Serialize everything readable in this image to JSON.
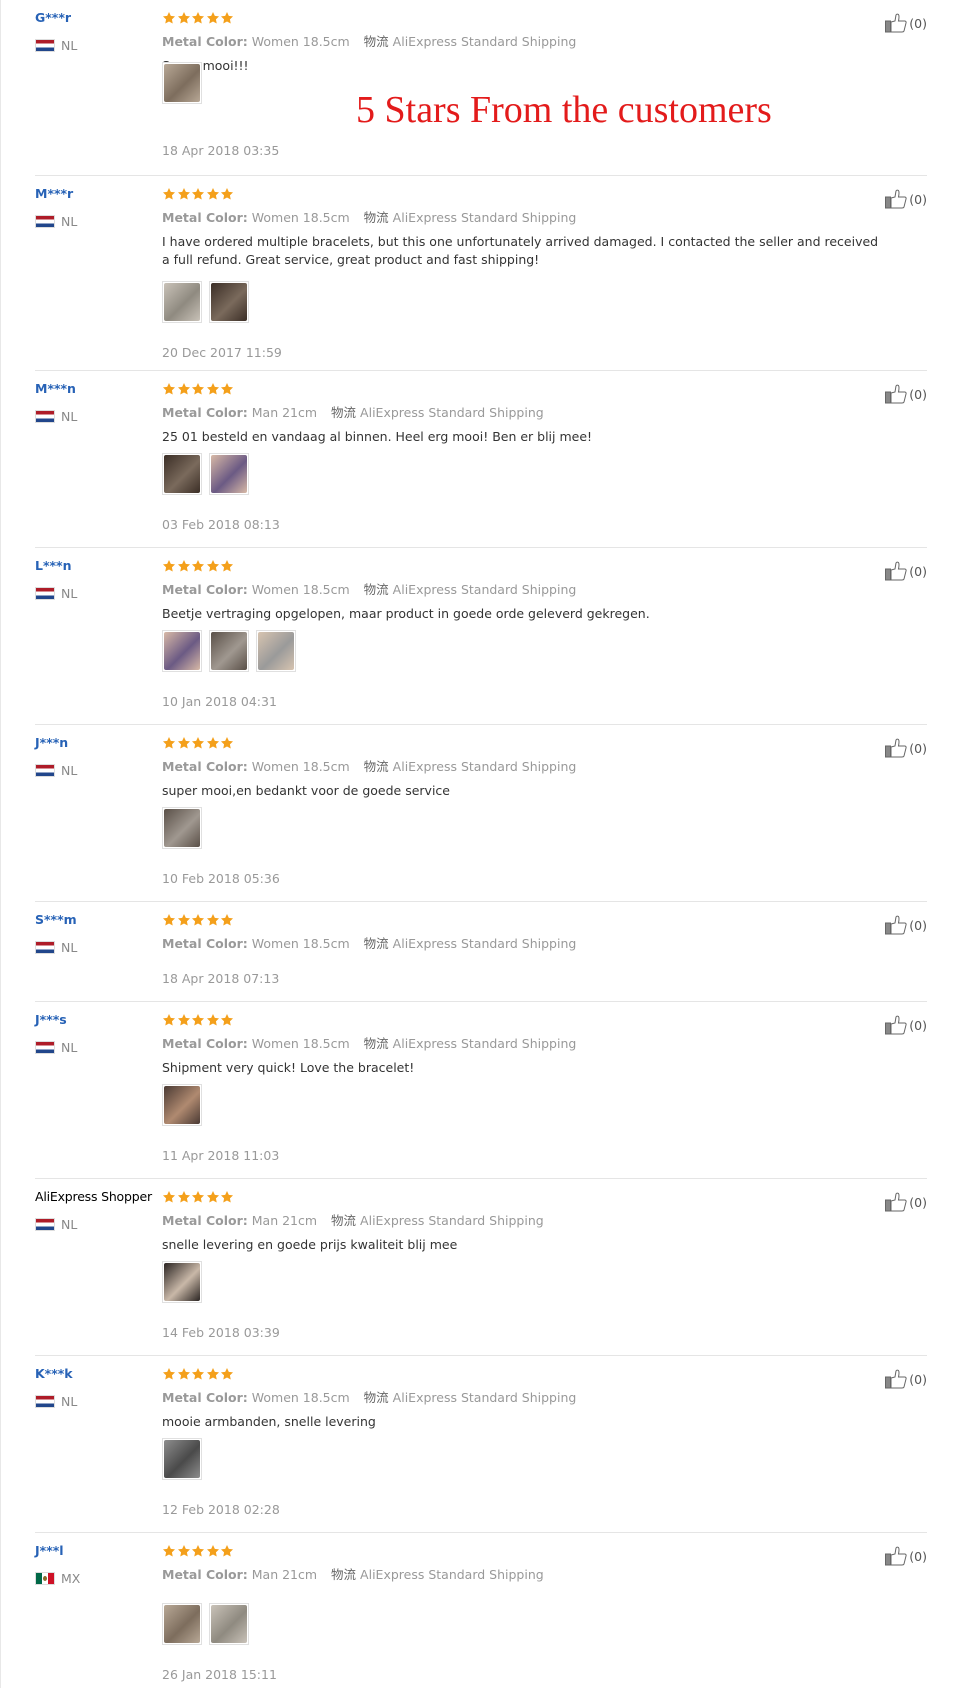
{
  "banner": {
    "text": "5 Stars From the customers",
    "color": "#e31b1b"
  },
  "attr_label": "Metal Color:",
  "shipping_label": "物流",
  "reviews": [
    {
      "user": "G***r",
      "country": "NL",
      "flag": "nl",
      "stars": 5,
      "color": "Women 18.5cm",
      "shipping": "AliExpress Standard Shipping",
      "text": "Super mooi!!!",
      "photos": [
        "photo-bracelet"
      ],
      "date": "18 Apr 2018 03:35",
      "likes": "(0)"
    },
    {
      "user": "M***r",
      "country": "NL",
      "flag": "nl",
      "stars": 5,
      "color": "Women 18.5cm",
      "shipping": "AliExpress Standard Shipping",
      "text": "I have ordered multiple bracelets, but this one unfortunately arrived damaged. I contacted the seller and received a full refund. Great service, great product and fast shipping!",
      "photos": [
        "photo-bracelet",
        "photo-bracelet"
      ],
      "date": "20 Dec 2017 11:59",
      "likes": "(0)"
    },
    {
      "user": "M***n",
      "country": "NL",
      "flag": "nl",
      "stars": 5,
      "color": "Man 21cm",
      "shipping": "AliExpress Standard Shipping",
      "text": "25 01 besteld en vandaag al binnen. Heel erg mooi! Ben er blij mee!",
      "photos": [
        "photo-bracelet",
        "photo-bracelet"
      ],
      "date": "03 Feb 2018 08:13",
      "likes": "(0)"
    },
    {
      "user": "L***n",
      "country": "NL",
      "flag": "nl",
      "stars": 5,
      "color": "Women 18.5cm",
      "shipping": "AliExpress Standard Shipping",
      "text": "Beetje vertraging opgelopen, maar product in goede orde geleverd gekregen.",
      "photos": [
        "photo-bracelet",
        "photo-bracelet",
        "photo-bracelet"
      ],
      "date": "10 Jan 2018 04:31",
      "likes": "(0)"
    },
    {
      "user": "J***n",
      "country": "NL",
      "flag": "nl",
      "stars": 5,
      "color": "Women 18.5cm",
      "shipping": "AliExpress Standard Shipping",
      "text": "super mooi,en bedankt voor de goede service",
      "photos": [
        "photo-bracelet"
      ],
      "date": "10 Feb 2018 05:36",
      "likes": "(0)"
    },
    {
      "user": "S***m",
      "country": "NL",
      "flag": "nl",
      "stars": 5,
      "color": "Women 18.5cm",
      "shipping": "AliExpress Standard Shipping",
      "text": "",
      "photos": [],
      "date": "18 Apr 2018 07:13",
      "likes": "(0)"
    },
    {
      "user": "J***s",
      "country": "NL",
      "flag": "nl",
      "stars": 5,
      "color": "Women 18.5cm",
      "shipping": "AliExpress Standard Shipping",
      "text": "Shipment very quick! Love the bracelet!",
      "photos": [
        "photo-bracelet"
      ],
      "date": "11 Apr 2018 11:03",
      "likes": "(0)"
    },
    {
      "user": "AliExpress Shopper",
      "country": "NL",
      "flag": "nl",
      "stars": 5,
      "color": "Man 21cm",
      "shipping": "AliExpress Standard Shipping",
      "text": "snelle levering en goede prijs kwaliteit blij mee",
      "photos": [
        "photo-bracelet"
      ],
      "date": "14 Feb 2018 03:39",
      "likes": "(0)"
    },
    {
      "user": "K***k",
      "country": "NL",
      "flag": "nl",
      "stars": 5,
      "color": "Women 18.5cm",
      "shipping": "AliExpress Standard Shipping",
      "text": "mooie armbanden, snelle levering",
      "photos": [
        "photo-bracelet"
      ],
      "date": "12 Feb 2018 02:28",
      "likes": "(0)"
    },
    {
      "user": "J***l",
      "country": "MX",
      "flag": "mx",
      "stars": 5,
      "color": "Man 21cm",
      "shipping": "AliExpress Standard Shipping",
      "text": "",
      "photos": [
        "photo-bracelet",
        "photo-bracelet"
      ],
      "date": "26 Jan 2018 15:11",
      "likes": "(0)"
    }
  ],
  "colors": {
    "star": "#f4a01b",
    "username": "#2762b6",
    "divider": "#e5e5e5"
  }
}
